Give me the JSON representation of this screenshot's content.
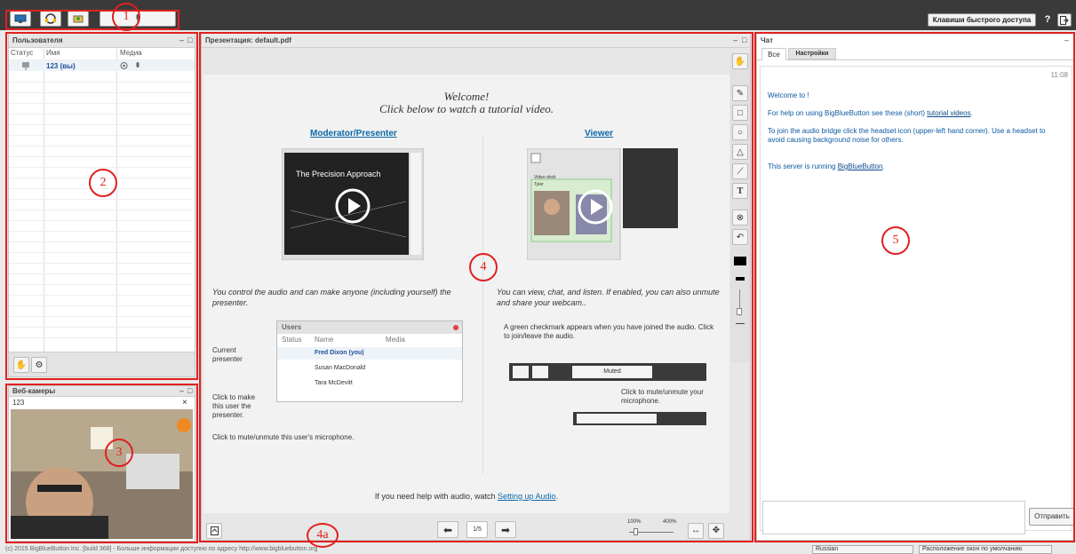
{
  "toolbar": {
    "shortcut_label": "Клавиши быстрого доступа",
    "help_label": "?"
  },
  "users_panel": {
    "title": "Пользователя",
    "columns": [
      "Статус",
      "Имя",
      "Медиа"
    ],
    "rows": [
      {
        "name": "123 (вы)"
      }
    ]
  },
  "webcam_panel": {
    "title": "Веб-камеры",
    "user": "123",
    "close": "×"
  },
  "presentation": {
    "title": "Презентация: default.pdf",
    "page_indicator": "1/5",
    "zoom_min": "100%",
    "zoom_max": "400%",
    "slide": {
      "welcome": "Welcome!",
      "subtitle": "Click below to watch a tutorial video.",
      "moderator_link": "Moderator/Presenter",
      "viewer_link": "Viewer",
      "video_caption": "The Precision Approach",
      "moderator_desc": "You control the audio and can make anyone (including yourself) the presenter.",
      "viewer_desc": "You can view, chat, and listen.  If enabled, you can also unmute and share your webcam..",
      "users_box_title": "Users",
      "users_box_cols": [
        "Status",
        "Name",
        "Media"
      ],
      "users_box_rows": [
        "Fred Dixon (you)",
        "Susan MacDonald",
        "Tara McDevitt"
      ],
      "current_presenter": "Current presenter",
      "click_make": "Click to make this user the presenter.",
      "click_mute_user": "Click to mute/unmute this user's microphone.",
      "checkmark_note": "A green checkmark appears when you have joined the audio.  Click to join/leave the audio.",
      "muted_label": "Muted",
      "mute_note": "Click to mute/unmute your microphone.",
      "audio_help_prefix": "If you need help with audio, watch ",
      "audio_help_link": "Setting up Audio",
      "audio_help_suffix": ".",
      "mini_webcam_label": "Video dock",
      "mini_user": "Tyler"
    }
  },
  "chat": {
    "title": "Чат",
    "tabs": [
      "Все",
      "Настройки"
    ],
    "time": "11:08",
    "welcome": "Welcome to !",
    "help_prefix": "For help on using BigBlueButton see these (short) ",
    "help_link": "tutorial videos",
    "help_suffix": ".",
    "audio_note": "To join the audio bridge click the headset icon (upper-left hand corner).  Use a headset to avoid causing background noise for others.",
    "server_prefix": "This server is running ",
    "server_link": "BigBlueButton",
    "server_suffix": ".",
    "send_label": "Отправить"
  },
  "footer": {
    "copyright": "(c) 2015 BigBlueButton Inc. [build 368] - Больше информации доступно по адресу http://www.bigbluebutton.org",
    "language": "Russian",
    "layout": "Расположение окон по умолчанию"
  },
  "annotations": [
    "1",
    "2",
    "3",
    "4",
    "4a",
    "5"
  ],
  "colors": {
    "accent": "#0a6aa8",
    "annotation": "#e02020",
    "topbar": "#3a3a3a"
  }
}
